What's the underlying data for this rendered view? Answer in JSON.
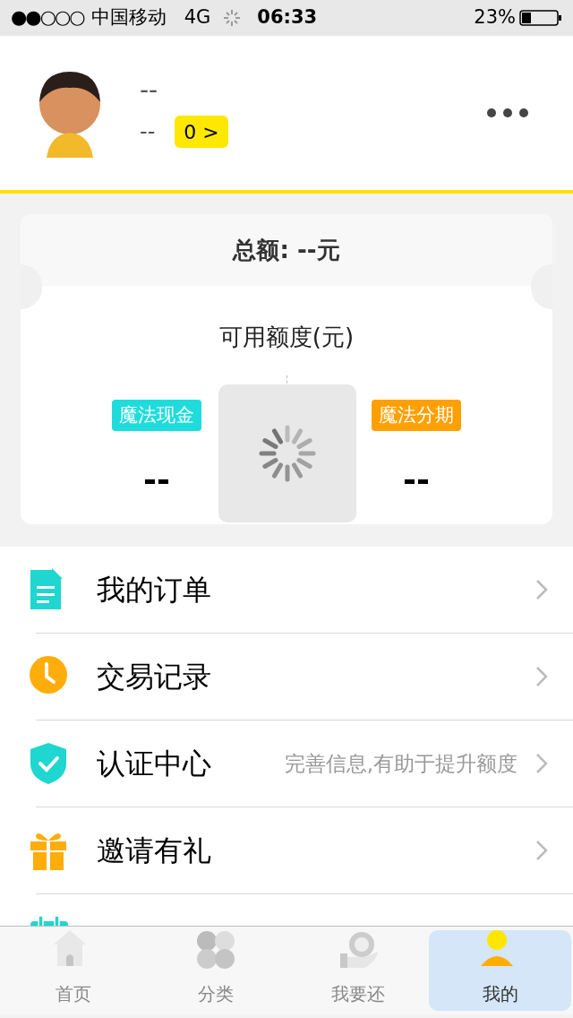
{
  "status_bar": {
    "signal": "●●○○○",
    "carrier": "中国移动",
    "network": "4G",
    "time": "06:33",
    "battery_percent": "23%"
  },
  "profile": {
    "name": "--",
    "id": "--",
    "badge": "0 >"
  },
  "card": {
    "total": "总额: --元",
    "available_title": "可用额度(元)",
    "products": [
      {
        "label": "魔法现金",
        "color": "#1fdcdc",
        "value": "--"
      },
      {
        "label": "魔法分期",
        "color": "#ffa000",
        "value": "--"
      }
    ]
  },
  "loading": true,
  "menu": [
    {
      "kind": "order",
      "label": "我的订单"
    },
    {
      "kind": "record",
      "label": "交易记录"
    },
    {
      "kind": "verify",
      "label": "认证中心",
      "hint": "完善信息,有助于提升额度"
    },
    {
      "kind": "gift",
      "label": "邀请有礼"
    },
    {
      "kind": "calendar"
    }
  ],
  "tabs": [
    {
      "kind": "home",
      "label": "首页",
      "selected": false
    },
    {
      "kind": "category",
      "label": "分类",
      "selected": false
    },
    {
      "kind": "repay",
      "label": "我要还",
      "selected": false
    },
    {
      "kind": "me",
      "label": "我的",
      "selected": true
    }
  ]
}
